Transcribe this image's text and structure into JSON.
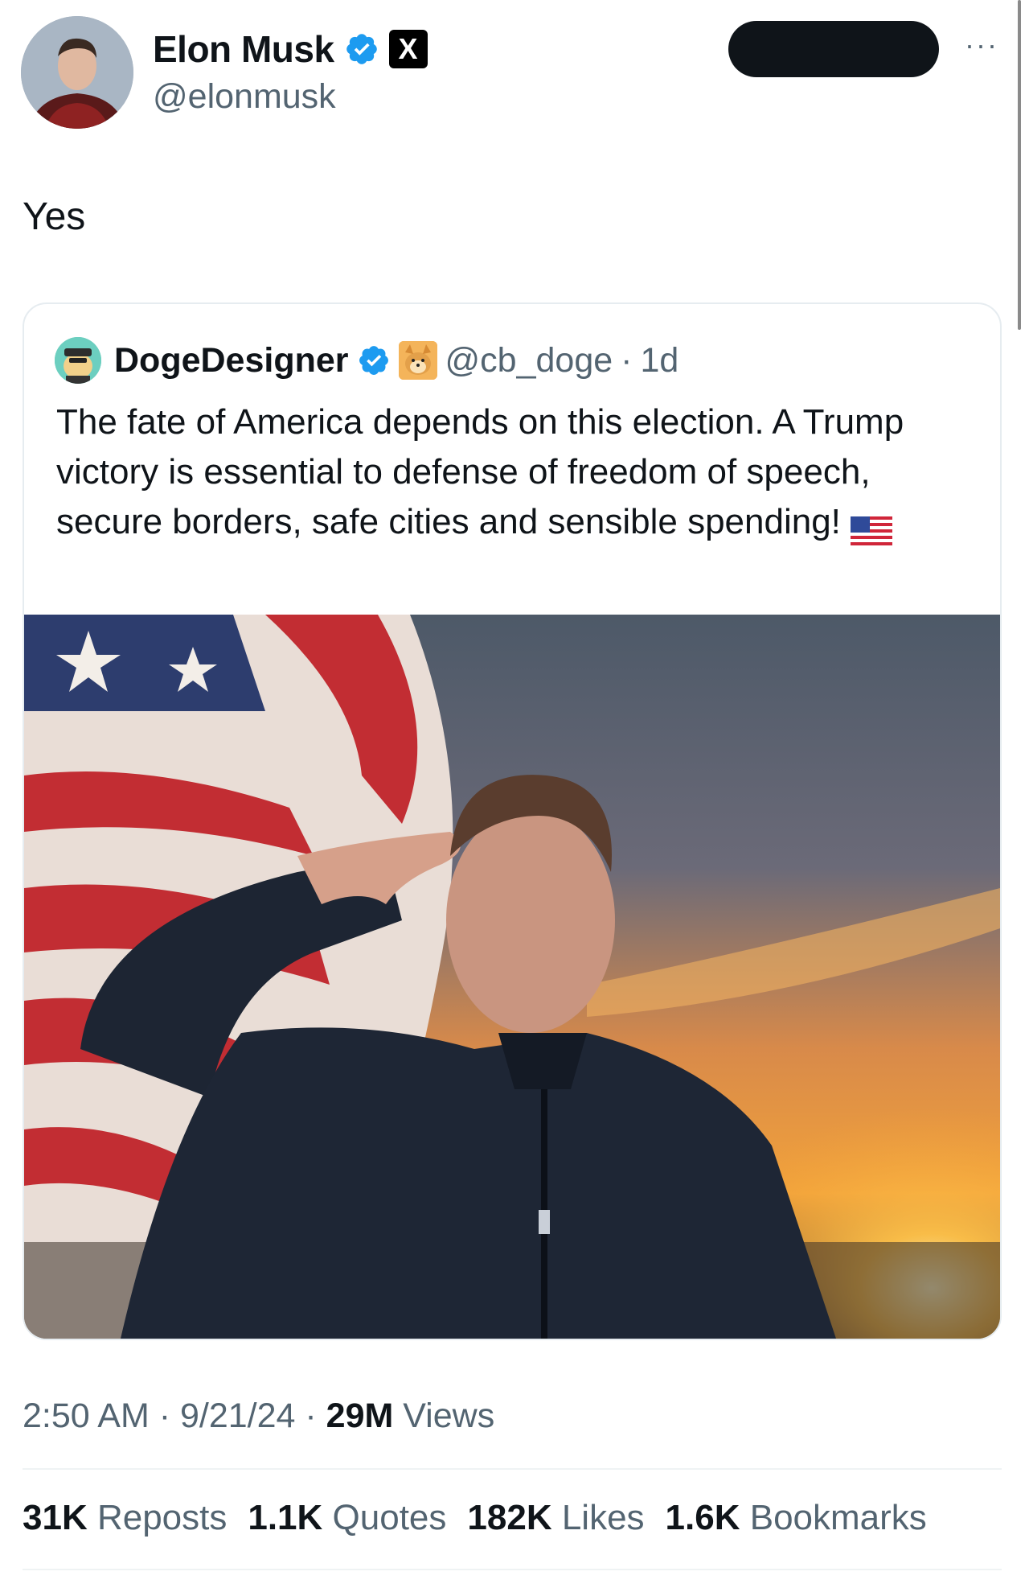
{
  "author": {
    "name": "Elon Musk",
    "handle": "@elonmusk",
    "verified_color": "#1d9bf0",
    "affiliate_badge": "X"
  },
  "tweet": {
    "text": "Yes"
  },
  "more_icon": "···",
  "quoted": {
    "name": "DogeDesigner",
    "handle": "@cb_doge",
    "separator": "·",
    "age": "1d",
    "text": "The fate of America depends on this election. A Trump victory is essential to defense of freedom of speech, secure borders, safe cities and sensible spending!",
    "emoji": "us-flag-emoji"
  },
  "meta": {
    "time": "2:50 AM",
    "sep1": " · ",
    "date": "9/21/24",
    "sep2": " · ",
    "views_count": "29M",
    "views_label": " Views"
  },
  "stats": [
    {
      "count": "31K",
      "label": " Reposts"
    },
    {
      "count": "1.1K",
      "label": " Quotes"
    },
    {
      "count": "182K",
      "label": " Likes"
    },
    {
      "count": "1.6K",
      "label": " Bookmarks"
    }
  ]
}
